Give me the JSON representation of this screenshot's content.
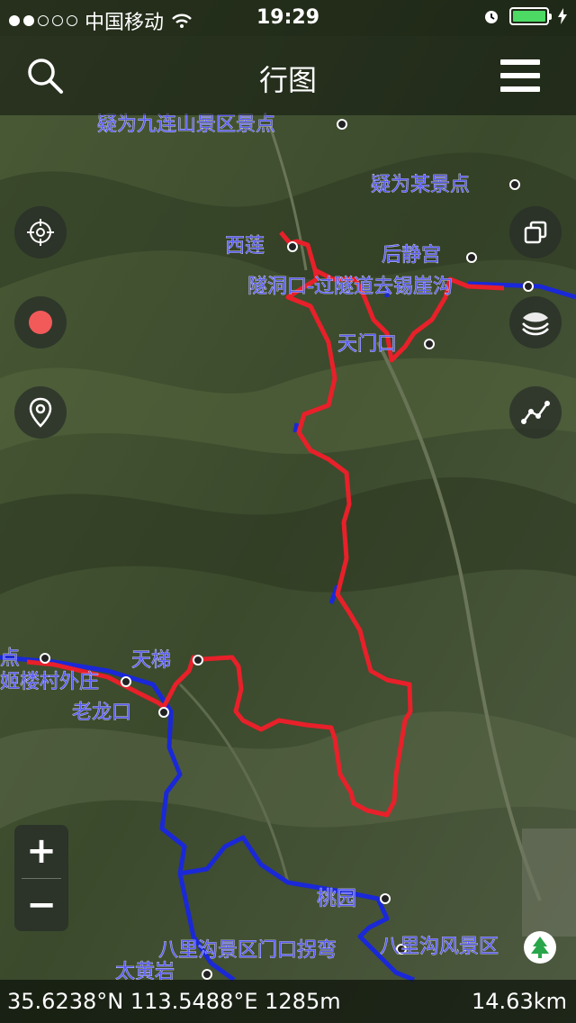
{
  "status_bar": {
    "carrier": "中国移动",
    "time": "19:29",
    "signal_bars_filled": 2,
    "signal_bars_total": 5,
    "battery_level": 1.0
  },
  "header": {
    "title": "行图",
    "search_icon": "search-icon",
    "menu_icon": "hamburger-menu-icon"
  },
  "map": {
    "labels": [
      {
        "id": "jiulian",
        "text": "疑为九连山景区景点"
      },
      {
        "id": "moujing",
        "text": "疑为某景点"
      },
      {
        "id": "xilian",
        "text": "西莲"
      },
      {
        "id": "houjing",
        "text": "后静宫"
      },
      {
        "id": "suidong",
        "text": "隧洞口-过隧道去锡崖沟"
      },
      {
        "id": "tianmen",
        "text": "天门口"
      },
      {
        "id": "dian",
        "text": "点"
      },
      {
        "id": "cunwai",
        "text": "姬楼村外庄"
      },
      {
        "id": "tianti",
        "text": "天梯"
      },
      {
        "id": "laolong",
        "text": "老龙口"
      },
      {
        "id": "taoyuan",
        "text": "桃园"
      },
      {
        "id": "balimen",
        "text": "八里沟景区门口拐弯"
      },
      {
        "id": "balifeng",
        "text": "八里沟风景区"
      },
      {
        "id": "taihuang",
        "text": "太黄岩"
      }
    ],
    "track_colors": {
      "recorded": "#e8202a",
      "reference": "#1a28d8"
    },
    "basemap_style": "satellite"
  },
  "controls": {
    "locate_icon": "crosshair-icon",
    "record_icon": "record-dot-icon",
    "pin_icon": "location-pin-icon",
    "layers_icon": "layers-copy-icon",
    "terrain_icon": "terrain-layers-icon",
    "track_icon": "track-line-icon",
    "zoom_in_label": "+",
    "zoom_out_label": "−",
    "compass_icon": "tree-compass-icon"
  },
  "bottom_bar": {
    "coordinates": "35.6238°N 113.5488°E 1285m",
    "distance": "14.63km"
  }
}
